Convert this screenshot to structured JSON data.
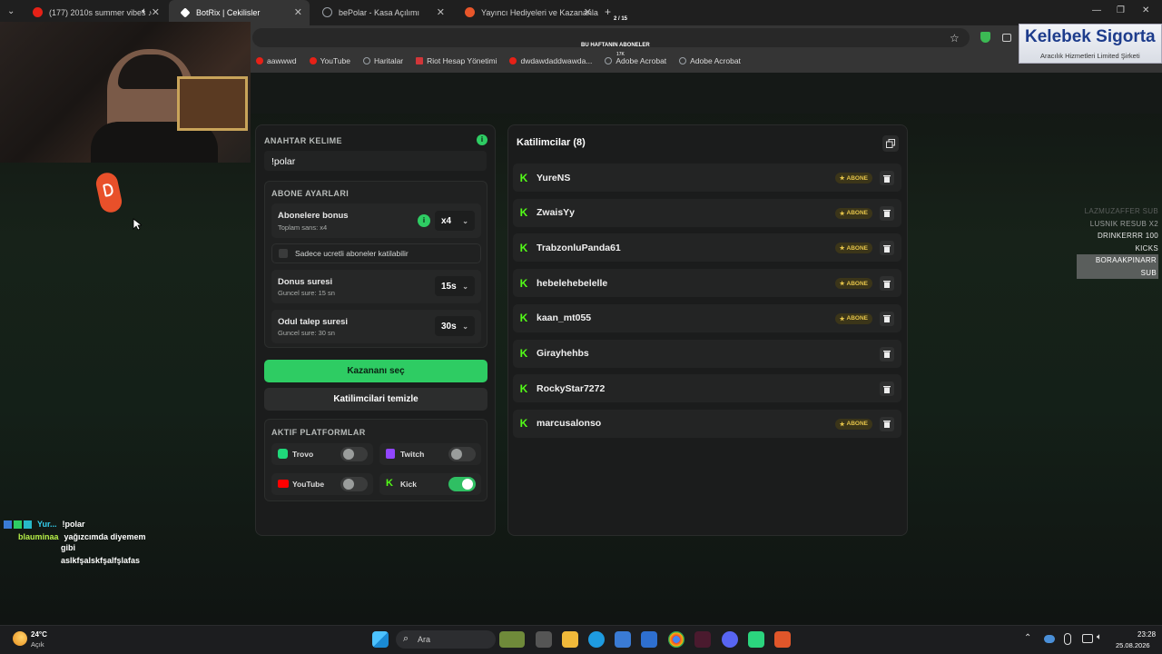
{
  "browser": {
    "tabs": [
      {
        "label": "(177) 2010s summer vibes ♪",
        "color": "#e62117"
      },
      {
        "label": "BotRix | Cekilisler",
        "color": "#ffffff"
      },
      {
        "label": "bePolar - Kasa Açılımı",
        "color": "#9aa0a6"
      },
      {
        "label": "Yayıncı Hediyeleri ve Kazananla",
        "color": "#e8562a"
      }
    ],
    "bookmarks": [
      {
        "label": "aawwwd",
        "color": "#e62117"
      },
      {
        "label": "YouTube",
        "color": "#e62117"
      },
      {
        "label": "Haritalar",
        "color": "#9aa0a6"
      },
      {
        "label": "Riot Hesap Yönetimi",
        "color": "#d13639"
      },
      {
        "label": "dwdawdaddwawda...",
        "color": "#e62117"
      },
      {
        "label": "Adobe Acrobat",
        "color": "#9aa0a6"
      },
      {
        "label": "Adobe Acrobat",
        "color": "#9aa0a6"
      }
    ]
  },
  "overlay": {
    "counter": "2 / 15",
    "subs_title": "BU HAFTANIN ABONELER",
    "subs_small": "17K",
    "sponsor_name": "Kelebek Sigorta",
    "sponsor_sub": "Aracılık Hizmetleri Limited Şirketi",
    "events": [
      "LAZMUZAFFER SUB",
      "LUSNIK RESUB X2",
      "DRINKERRR 100 KICKS",
      "BORAAKPINARR SUB"
    ],
    "chat": [
      {
        "user": "Yur...",
        "msg": "!polar"
      },
      {
        "user": "blauminaa",
        "msg": "yağızcımda diyemem"
      },
      {
        "user": "",
        "msg": "gibi"
      },
      {
        "user": "",
        "msg": "aslkfşalskfşalfşlafas"
      }
    ]
  },
  "left_panel": {
    "keyword_label": "ANAHTAR KELIME",
    "keyword_value": "!polar",
    "sub_settings_label": "ABONE AYARLARI",
    "sub_bonus": {
      "title": "Abonelere bonus",
      "sub": "Toplam sans: x4",
      "value": "x4"
    },
    "only_paid_label": "Sadece ucretli aboneler katilabilir",
    "duration": {
      "title": "Donus suresi",
      "sub": "Guncel sure: 15 sn",
      "value": "15s"
    },
    "claim": {
      "title": "Odul talep suresi",
      "sub": "Guncel sure: 30 sn",
      "value": "30s"
    },
    "pick_button": "Kazananı seç",
    "clear_button": "Katilimcilari temizle",
    "platforms_label": "AKTIF PLATFORMLAR",
    "platforms": [
      {
        "name": "Trovo",
        "on": false,
        "color": "#1fd87a"
      },
      {
        "name": "Twitch",
        "on": false,
        "color": "#9146ff"
      },
      {
        "name": "YouTube",
        "on": false,
        "color": "#ff0000"
      },
      {
        "name": "Kick",
        "on": true,
        "color": "#53fc18"
      }
    ]
  },
  "participants": {
    "title": "Katilimcilar (8)",
    "badge_label": "ABONE",
    "items": [
      {
        "name": "YureNS",
        "sub": true
      },
      {
        "name": "ZwaisYy",
        "sub": true
      },
      {
        "name": "TrabzonluPanda61",
        "sub": true
      },
      {
        "name": "hebelehebelelle",
        "sub": true
      },
      {
        "name": "kaan_mt055",
        "sub": true
      },
      {
        "name": "Girayhehbs",
        "sub": false
      },
      {
        "name": "RockyStar7272",
        "sub": false
      },
      {
        "name": "marcusalonso",
        "sub": true
      }
    ]
  },
  "taskbar": {
    "temp": "24°C",
    "weather": "Açık",
    "search": "Ara",
    "time": "23:28",
    "date": "25.08.2026"
  },
  "colors": {
    "accent": "#2ecc63",
    "kick": "#53fc18",
    "badge": "#e5c44a"
  }
}
